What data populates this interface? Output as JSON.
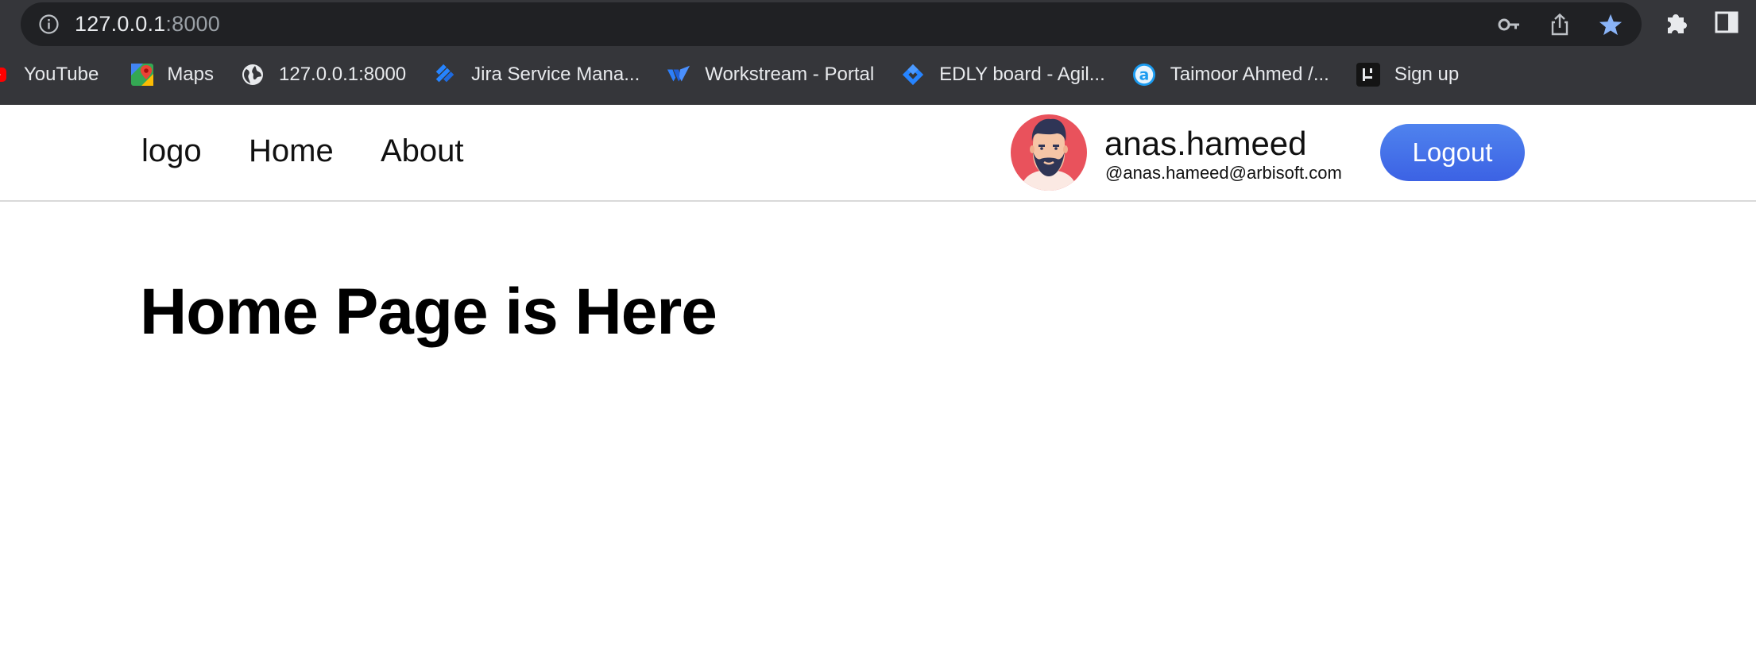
{
  "browser": {
    "url_host": "127.0.0.1",
    "url_port": ":8000",
    "bookmarks": [
      {
        "label": "YouTube",
        "icon": "youtube-icon"
      },
      {
        "label": "Maps",
        "icon": "maps-icon"
      },
      {
        "label": "127.0.0.1:8000",
        "icon": "globe-icon"
      },
      {
        "label": "Jira Service Mana...",
        "icon": "jira-icon"
      },
      {
        "label": "Workstream - Portal",
        "icon": "workstream-icon"
      },
      {
        "label": "EDLY board - Agil...",
        "icon": "jira-board-icon"
      },
      {
        "label": "Taimoor Ahmed /...",
        "icon": "assembla-icon"
      },
      {
        "label": "Sign up",
        "icon": "signup-icon"
      }
    ],
    "accent": "#8ab4f8"
  },
  "header": {
    "logo": "logo",
    "nav": [
      {
        "label": "Home"
      },
      {
        "label": "About"
      }
    ],
    "user": {
      "name": "anas.hameed",
      "email": "@anas.hameed@arbisoft.com"
    },
    "logout_label": "Logout",
    "logout_color": "#4470ea"
  },
  "main": {
    "heading": "Home Page is Here"
  }
}
